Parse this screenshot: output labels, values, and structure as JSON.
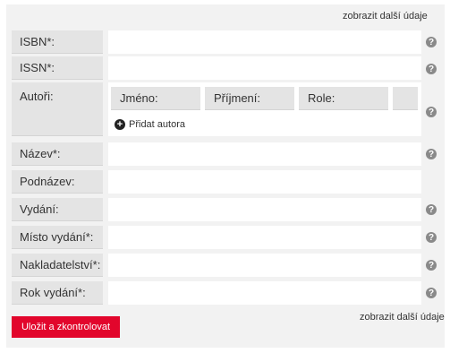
{
  "links": {
    "more_top": "zobrazit další údaje",
    "more_bottom": "zobrazit další údaje"
  },
  "fields": {
    "isbn": {
      "label": "ISBN*:",
      "value": ""
    },
    "issn": {
      "label": "ISSN*:",
      "value": ""
    },
    "nazev": {
      "label": "Název*:",
      "value": ""
    },
    "podnazev": {
      "label": "Podnázev:",
      "value": ""
    },
    "vydani": {
      "label": "Vydání:",
      "value": ""
    },
    "misto": {
      "label": "Místo vydání*:",
      "value": ""
    },
    "nakladatelstvi": {
      "label": "Nakladatelství*:",
      "value": ""
    },
    "rok": {
      "label": "Rok vydání*:",
      "value": ""
    }
  },
  "authors": {
    "label": "Autoři:",
    "columns": [
      "Jméno:",
      "Příjmení:",
      "Role:"
    ],
    "add_label": "Přidat autora",
    "add_icon": "plus-circle-icon"
  },
  "help_icon": {
    "glyph": "?",
    "name": "question-icon"
  },
  "submit_label": "Uložit a zkontrolovat",
  "colors": {
    "accent": "#e2062c",
    "panel": "#f2f2f2",
    "label_bg": "#e4e4e4"
  }
}
